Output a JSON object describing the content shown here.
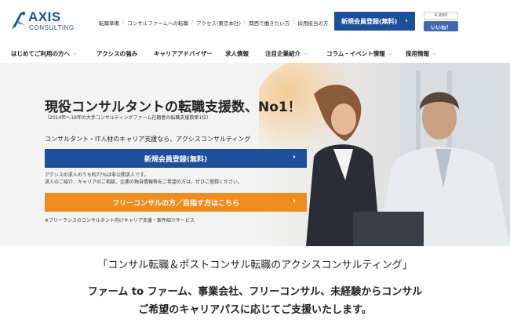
{
  "logo": {
    "name": "AXIS",
    "sub": "CONSULTING"
  },
  "util_links": [
    "転職準備",
    "コンサルファームへの転職",
    "アクセス(東京本社)",
    "関西で働きたい方",
    "採用担当の方"
  ],
  "header": {
    "register_label": "新規会員登録(無料)",
    "fb_count": "4,890",
    "fb_like": "いいね！"
  },
  "nav": {
    "items": [
      {
        "label": "はじめてご利用の方へ",
        "dropdown": true
      },
      {
        "label": "アクシスの強み",
        "dropdown": false
      },
      {
        "label": "キャリアアドバイザー",
        "dropdown": false
      },
      {
        "label": "求人情報",
        "dropdown": false
      },
      {
        "label": "注目企業紹介",
        "dropdown": true
      },
      {
        "label": "コラム・イベント情報",
        "dropdown": true
      },
      {
        "label": "採用情報",
        "dropdown": true
      }
    ]
  },
  "hero": {
    "title": "現役コンサルタントの転職支援数、No1！",
    "note": "（2014年～19年の大手コンサルティングファーム在籍者の転職支援数第1位）",
    "lead": "コンサルタント・IT人材のキャリア支援なら、アクシスコンサルティング",
    "register_button": "新規会員登録(無料)",
    "register_note1": "アクシスの求人のうち約77%は非公開求人です。",
    "register_note2": "求人のご紹介、キャリアのご相談、企業の独自情報等をご希望の方は、ぜひご登録ください。",
    "freelance_button": "フリーコンサルの方／目指す方はこちら",
    "freelance_note": "※フリーランスのコンサルタント向けキャリア支援・案件紹介サービス"
  },
  "tagline": "「コンサル転職＆ポストコンサル転職のアクシスコンサルティング」",
  "desc": {
    "line1": "ファーム to ファーム、事業会社、フリーコンサル、未経験からコンサル",
    "line2": "ご希望のキャリアパスに応じてご支援いたします。"
  },
  "colors": {
    "brand_blue": "#1e4f9b",
    "orange": "#f08c1e",
    "fb_blue": "#4267b2"
  },
  "icons": {
    "logo_mark": "axis-logo-icon",
    "chevron": "chevron-right-icon",
    "dropdown": "chevron-down-icon"
  }
}
